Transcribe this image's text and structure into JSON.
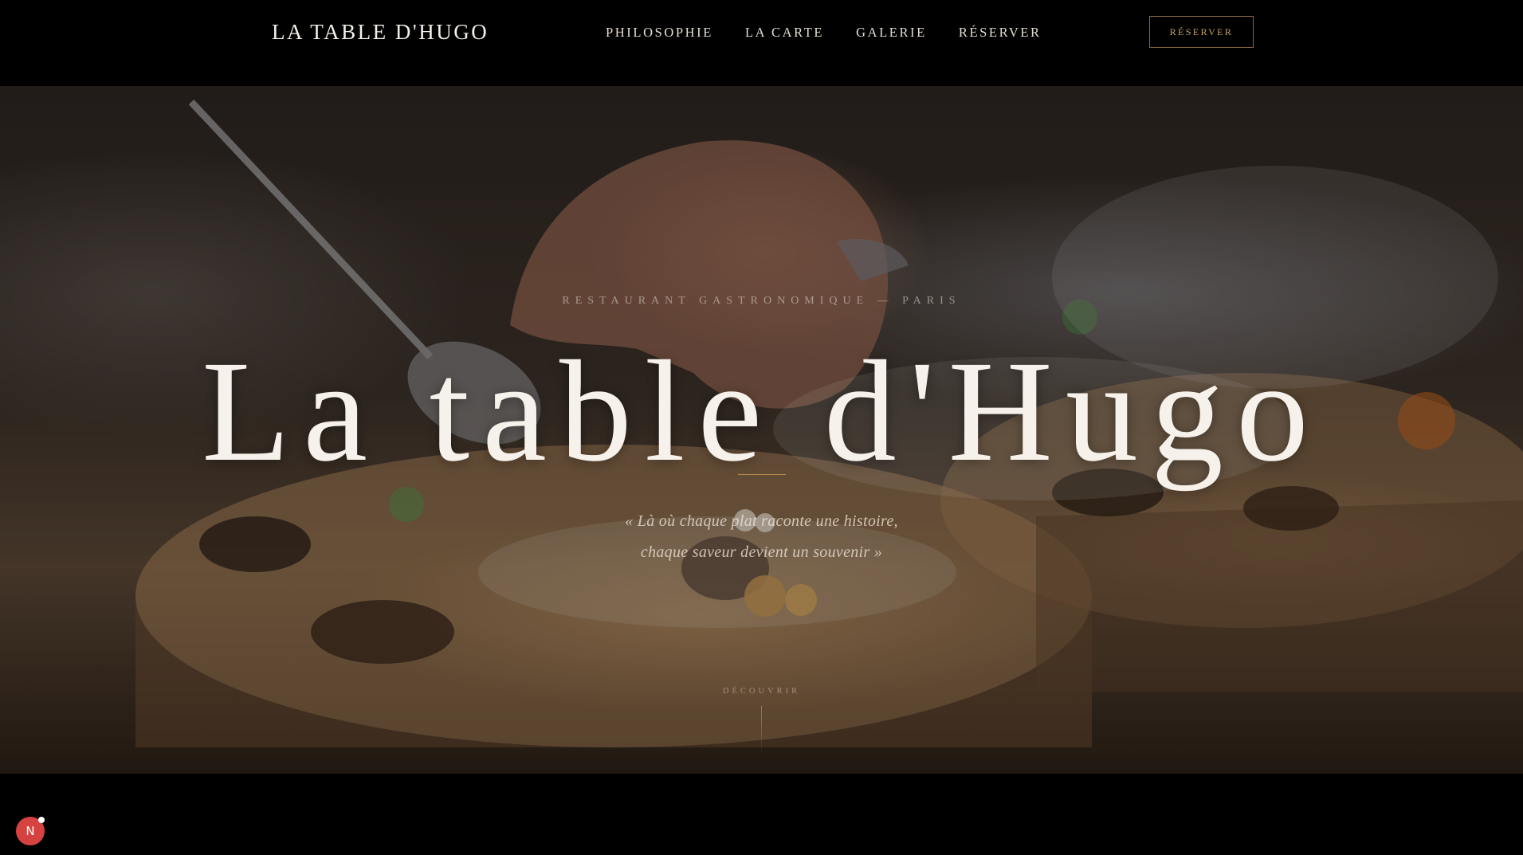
{
  "header": {
    "brand": "LA TABLE D'HUGO",
    "nav": [
      {
        "label": "PHILOSOPHIE"
      },
      {
        "label": "LA CARTE"
      },
      {
        "label": "GALERIE"
      },
      {
        "label": "RÉSERVER"
      }
    ],
    "cta_label": "RÉSERVER"
  },
  "hero": {
    "kicker": "RESTAURANT GASTRONOMIQUE — PARIS",
    "title": "La table d'Hugo",
    "quote_line1": "« Là où chaque plat raconte une histoire,",
    "quote_line2": "chaque saveur devient un souvenir »",
    "scroll_label": "DÉCOUVRIR",
    "image_icon": "chef-plating-dish-photo"
  },
  "badge": {
    "label": "N",
    "icon": "notification-badge-icon"
  },
  "colors": {
    "background": "#000000",
    "accent_gold": "#b48a4d",
    "cta_border": "#8b6a3b",
    "cta_text": "#c9a56a",
    "badge_red": "#d6423f"
  }
}
